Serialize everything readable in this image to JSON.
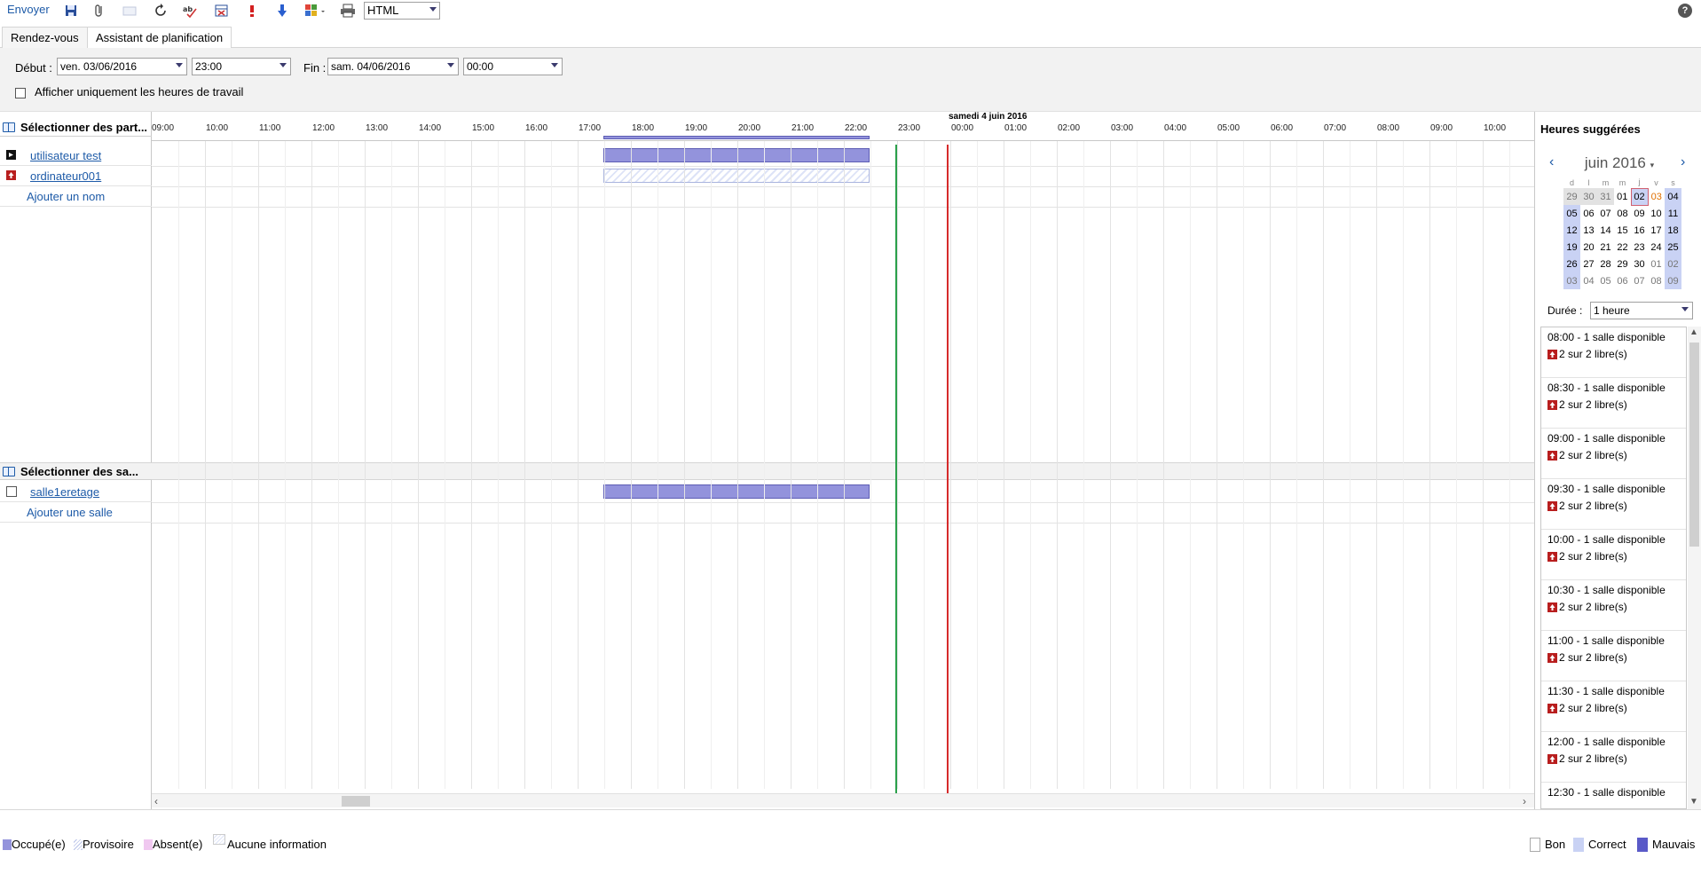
{
  "toolbar": {
    "send_label": "Envoyer",
    "format_value": "HTML",
    "icons": [
      "save-icon",
      "attach-icon",
      "note-icon",
      "refresh-icon",
      "spellcheck-icon",
      "cancel-icon",
      "importance-high-icon",
      "importance-low-icon",
      "categories-icon",
      "print-icon"
    ],
    "help_label": "?"
  },
  "tabs": [
    {
      "label": "Rendez-vous",
      "active": false
    },
    {
      "label": "Assistant de planification",
      "active": true
    }
  ],
  "form": {
    "start_label": "Début :",
    "start_date": "ven. 03/06/2016",
    "start_time": "23:00",
    "end_label": "Fin :",
    "end_date": "sam. 04/06/2016",
    "end_time": "00:00",
    "working_hours_label": "Afficher uniquement les heures de travail",
    "working_hours_checked": false
  },
  "participants": {
    "header": "Sélectionner des part...",
    "items": [
      {
        "name": "utilisateur test",
        "icon": "organizer-icon"
      },
      {
        "name": "ordinateur001",
        "icon": "required-attendee-icon"
      }
    ],
    "add_label": "Ajouter un nom"
  },
  "rooms": {
    "header": "Sélectionner des sa...",
    "items": [
      {
        "name": "salle1eretage"
      }
    ],
    "add_label": "Ajouter une salle"
  },
  "timeline": {
    "day_label": "samedi 4 juin 2016",
    "hours": [
      "09:00",
      "10:00",
      "11:00",
      "12:00",
      "13:00",
      "14:00",
      "15:00",
      "16:00",
      "17:00",
      "18:00",
      "19:00",
      "20:00",
      "21:00",
      "22:00",
      "23:00",
      "00:00",
      "01:00",
      "02:00",
      "03:00",
      "04:00",
      "05:00",
      "06:00",
      "07:00",
      "08:00",
      "09:00",
      "10:00"
    ]
  },
  "suggested": {
    "title": "Heures suggérées",
    "month": "juin 2016",
    "weekdays": [
      "d",
      "l",
      "m",
      "m",
      "j",
      "v",
      "s"
    ],
    "weeks": [
      [
        "29",
        "30",
        "31",
        "01",
        "02",
        "03",
        "04"
      ],
      [
        "05",
        "06",
        "07",
        "08",
        "09",
        "10",
        "11"
      ],
      [
        "12",
        "13",
        "14",
        "15",
        "16",
        "17",
        "18"
      ],
      [
        "19",
        "20",
        "21",
        "22",
        "23",
        "24",
        "25"
      ],
      [
        "26",
        "27",
        "28",
        "29",
        "30",
        "01",
        "02"
      ],
      [
        "03",
        "04",
        "05",
        "06",
        "07",
        "08",
        "09"
      ]
    ],
    "duration_label": "Durée :",
    "duration_value": "1 heure",
    "slots": [
      {
        "time": "08:00 - 1 salle disponible",
        "free": "2 sur 2 libre(s)"
      },
      {
        "time": "08:30 - 1 salle disponible",
        "free": "2 sur 2 libre(s)"
      },
      {
        "time": "09:00 - 1 salle disponible",
        "free": "2 sur 2 libre(s)"
      },
      {
        "time": "09:30 - 1 salle disponible",
        "free": "2 sur 2 libre(s)"
      },
      {
        "time": "10:00 - 1 salle disponible",
        "free": "2 sur 2 libre(s)"
      },
      {
        "time": "10:30 - 1 salle disponible",
        "free": "2 sur 2 libre(s)"
      },
      {
        "time": "11:00 - 1 salle disponible",
        "free": "2 sur 2 libre(s)"
      },
      {
        "time": "11:30 - 1 salle disponible",
        "free": "2 sur 2 libre(s)"
      },
      {
        "time": "12:00 - 1 salle disponible",
        "free": "2 sur 2 libre(s)"
      },
      {
        "time": "12:30 - 1 salle disponible",
        "free": ""
      }
    ]
  },
  "legend": {
    "busy": "Occupé(e)",
    "tentative": "Provisoire",
    "away": "Absent(e)",
    "no_info": "Aucune information",
    "good": "Bon",
    "fair": "Correct",
    "poor": "Mauvais"
  },
  "colors": {
    "accent": "#1e5ba8",
    "busy": "#9393dc",
    "start_line": "#2aa04a",
    "end_line": "#d62b2b"
  }
}
